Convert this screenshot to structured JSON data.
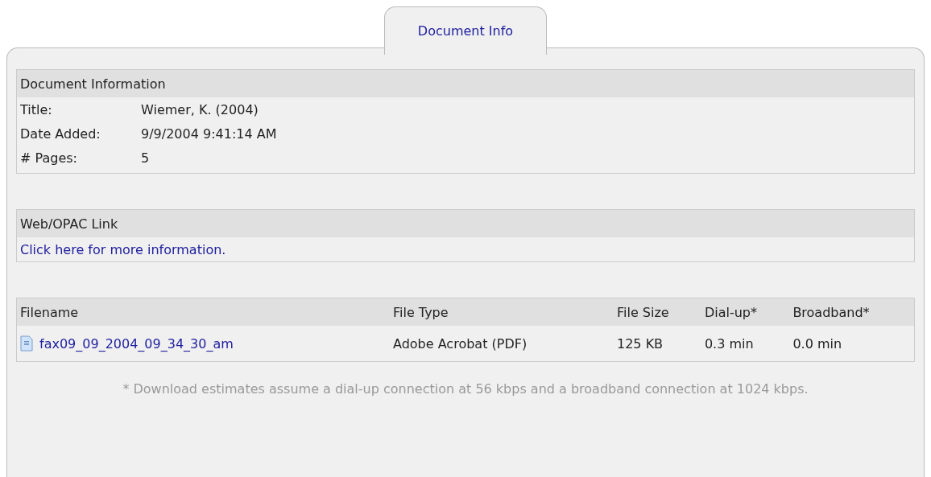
{
  "tabs": [
    {
      "label": "Document Info",
      "selected": true
    }
  ],
  "document_information": {
    "heading": "Document Information",
    "fields": [
      {
        "label": "Title:",
        "value": "Wiemer, K. (2004)"
      },
      {
        "label": "Date Added:",
        "value": "9/9/2004 9:41:14 AM"
      },
      {
        "label": "# Pages:",
        "value": "5"
      }
    ]
  },
  "web_link": {
    "heading": "Web/OPAC Link",
    "link": "Click here for more information."
  },
  "files": {
    "columns": [
      "Filename",
      "File Type",
      "File Size",
      "Dial-up*",
      "Broadband*"
    ],
    "rows": [
      {
        "filename": "fax09_09_2004_09_34_30_am",
        "file_type": "Adobe Acrobat (PDF)",
        "file_size": "125 KB",
        "dial_up": "0.3 min",
        "broadband": "0.0 min"
      }
    ]
  },
  "footnote": "* Download estimates assume a dial-up connection at 56 kbps and a broadband connection at 1024 kbps."
}
